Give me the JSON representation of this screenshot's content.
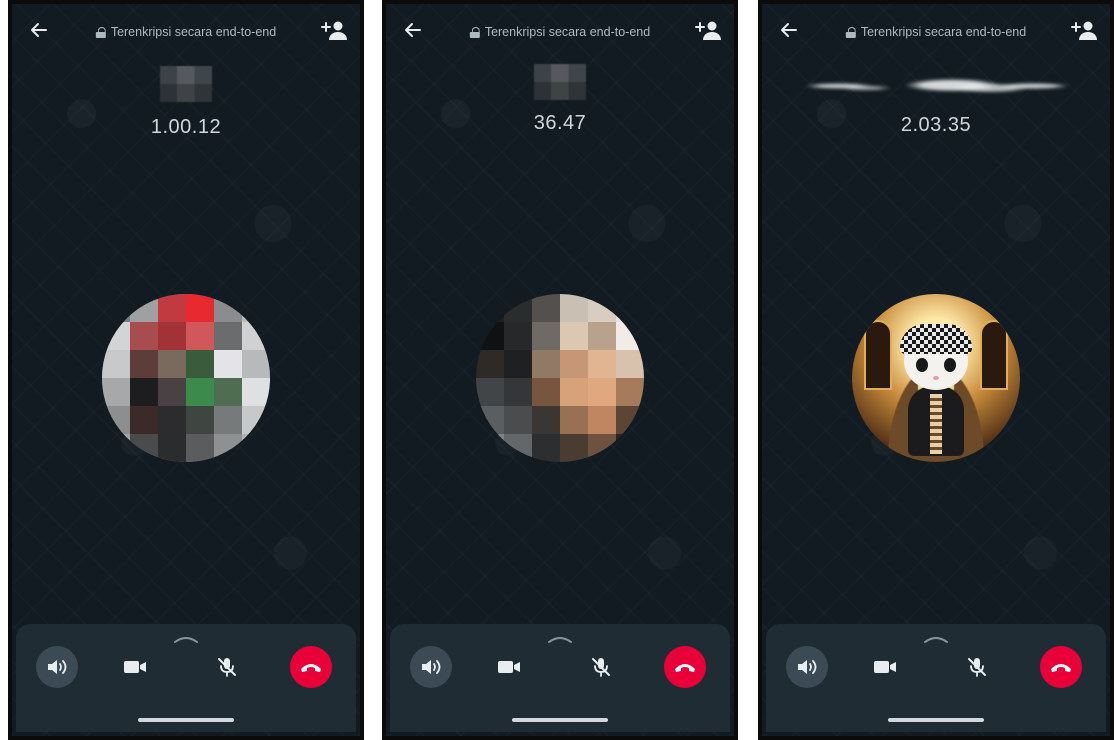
{
  "calls": [
    {
      "encryption_label": "Terenkripsi secara end-to-end",
      "timer": "1.00.12"
    },
    {
      "encryption_label": "Terenkripsi secara end-to-end",
      "timer": "36.47"
    },
    {
      "encryption_label": "Terenkripsi secara end-to-end",
      "timer": "2.03.35"
    }
  ],
  "icons": {
    "back": "arrow-left-icon",
    "lock": "lock-icon",
    "add_participant": "person-add-icon",
    "expand": "chevron-up-icon",
    "speaker": "speaker-icon",
    "video": "video-camera-icon",
    "mute": "mic-off-icon",
    "end_call": "phone-hangup-icon"
  },
  "colors": {
    "background": "#111b21",
    "control_panel": "#1f2c34",
    "end_call": "#ea0038",
    "speaker_active": "#3b4a54",
    "text_primary": "#d1d7db",
    "text_secondary": "#aebac1"
  }
}
